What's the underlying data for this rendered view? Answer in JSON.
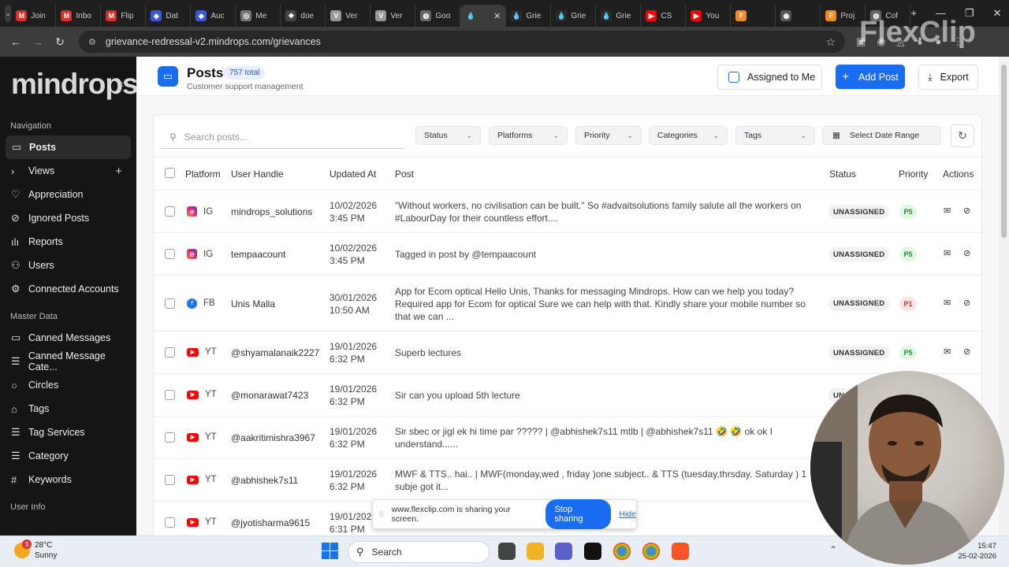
{
  "browser": {
    "tabs": [
      {
        "label": "Join",
        "icon": "gmail-icon",
        "color": "#d93025",
        "glyph": "M"
      },
      {
        "label": "Inbo",
        "icon": "gmail-icon",
        "color": "#d93025",
        "glyph": "M"
      },
      {
        "label": "Flip",
        "icon": "gmail-icon",
        "color": "#d93025",
        "glyph": "M"
      },
      {
        "label": "Dat",
        "icon": "shield-icon",
        "color": "#3a5bd9",
        "glyph": "◆"
      },
      {
        "label": "Auc",
        "icon": "shield-icon",
        "color": "#3a5bd9",
        "glyph": "◆"
      },
      {
        "label": "Me",
        "icon": "app-icon",
        "color": "#777",
        "glyph": "◎"
      },
      {
        "label": "doe",
        "icon": "app-icon",
        "color": "#444",
        "glyph": "❖"
      },
      {
        "label": "Ver",
        "icon": "app-icon",
        "color": "#999",
        "glyph": "V"
      },
      {
        "label": "Ver",
        "icon": "app-icon",
        "color": "#999",
        "glyph": "V"
      },
      {
        "label": "Goo",
        "icon": "globe-icon",
        "color": "#666",
        "glyph": "◍"
      },
      {
        "label": "",
        "icon": "drop-icon",
        "color": "#3c3c3c",
        "glyph": "💧",
        "active": true
      },
      {
        "label": "Grie",
        "icon": "drop-icon",
        "color": "#2a2a2a",
        "glyph": "💧"
      },
      {
        "label": "Grie",
        "icon": "drop-icon",
        "color": "#2a2a2a",
        "glyph": "💧"
      },
      {
        "label": "Grie",
        "icon": "drop-icon",
        "color": "#2a2a2a",
        "glyph": "💧"
      },
      {
        "label": "CS",
        "icon": "youtube-icon",
        "color": "#ff0000",
        "glyph": "▶"
      },
      {
        "label": "You",
        "icon": "youtube-icon",
        "color": "#ff0000",
        "glyph": "▶"
      },
      {
        "label": "",
        "icon": "app-icon",
        "color": "#f58a1f",
        "glyph": "F"
      },
      {
        "label": "",
        "icon": "record-icon",
        "color": "#555",
        "glyph": "◉"
      },
      {
        "label": "Proj",
        "icon": "app-icon",
        "color": "#f58a1f",
        "glyph": "F"
      },
      {
        "label": "Cof",
        "icon": "globe-icon",
        "color": "#666",
        "glyph": "◍"
      }
    ],
    "url": "grievance-redressal-v2.mindrops.com/grievances",
    "watermark": "FlexClip"
  },
  "sidebar": {
    "logo": "mindrops",
    "sections": [
      {
        "heading": "Navigation",
        "items": [
          {
            "label": "Posts",
            "icon": "message-icon",
            "glyph": "▭",
            "active": true
          },
          {
            "label": "Views",
            "icon": "chevron-right-icon",
            "glyph": "›",
            "plus": true
          },
          {
            "label": "Appreciation",
            "icon": "heart-icon",
            "glyph": "♡"
          },
          {
            "label": "Ignored Posts",
            "icon": "ban-icon",
            "glyph": "⊘"
          },
          {
            "label": "Reports",
            "icon": "bar-chart-icon",
            "glyph": "ılı"
          },
          {
            "label": "Users",
            "icon": "users-icon",
            "glyph": "⚇"
          },
          {
            "label": "Connected Accounts",
            "icon": "gear-icon",
            "glyph": "⚙"
          }
        ]
      },
      {
        "heading": "Master Data",
        "items": [
          {
            "label": "Canned Messages",
            "icon": "message-icon",
            "glyph": "▭"
          },
          {
            "label": "Canned Message Cate...",
            "icon": "layers-icon",
            "glyph": "☰"
          },
          {
            "label": "Circles",
            "icon": "circle-icon",
            "glyph": "○"
          },
          {
            "label": "Tags",
            "icon": "tag-icon",
            "glyph": "⌂"
          },
          {
            "label": "Tag Services",
            "icon": "list-icon",
            "glyph": "☰"
          },
          {
            "label": "Category",
            "icon": "list-icon",
            "glyph": "☰"
          },
          {
            "label": "Keywords",
            "icon": "hash-icon",
            "glyph": "#"
          }
        ]
      },
      {
        "heading": "User Info",
        "items": []
      }
    ]
  },
  "header": {
    "title": "Posts",
    "count": "757 total",
    "subtitle": "Customer support management",
    "assigned_label": "Assigned to Me",
    "add_label": "Add Post",
    "export_label": "Export"
  },
  "filters": {
    "search_placeholder": "Search posts...",
    "status": "Status",
    "platforms": "Platforms",
    "priority": "Priority",
    "categories": "Categories",
    "tags": "Tags",
    "date": "Select Date Range"
  },
  "table": {
    "columns": {
      "platform": "Platform",
      "handle": "User Handle",
      "updated": "Updated At",
      "post": "Post",
      "status": "Status",
      "priority": "Priority",
      "actions": "Actions"
    },
    "rows": [
      {
        "platform": "IG",
        "handle": "mindrops_solutions",
        "date": "10/02/2026",
        "time": "3:45 PM",
        "post": "\"Without workers, no civilisation can be built.\" So #advaitsolutions family salute all the workers on #LabourDay for their countless effort....",
        "status": "UNASSIGNED",
        "priority": "P5"
      },
      {
        "platform": "IG",
        "handle": "tempaacount",
        "date": "10/02/2026",
        "time": "3:45 PM",
        "post": "Tagged in post by @tempaacount",
        "status": "UNASSIGNED",
        "priority": "P5"
      },
      {
        "platform": "FB",
        "handle": "Unis Malla",
        "date": "30/01/2026",
        "time": "10:50 AM",
        "post": "App for Ecom optical Hello Unis, Thanks for messaging Mindrops. How can we help you today? Required app for Ecom for optical Sure we can help with that. Kindly share your mobile number so that we can ...",
        "status": "UNASSIGNED",
        "priority": "P1"
      },
      {
        "platform": "YT",
        "handle": "@shyamalanaik2227",
        "date": "19/01/2026",
        "time": "6:32 PM",
        "post": "Superb lectures",
        "status": "UNASSIGNED",
        "priority": "P5"
      },
      {
        "platform": "YT",
        "handle": "@monarawat7423",
        "date": "19/01/2026",
        "time": "6:32 PM",
        "post": "Sir can you upload 5th lecture",
        "status": "UN",
        "priority": ""
      },
      {
        "platform": "YT",
        "handle": "@aakritimishra3967",
        "date": "19/01/2026",
        "time": "6:32 PM",
        "post": "Sir sbec or jigl ek hi time par ????? | @abhishek7s11 mtlb | @abhishek7s11 🤣 🤣 ok ok I understand......",
        "status": "",
        "priority": ""
      },
      {
        "platform": "YT",
        "handle": "@abhishek7s11",
        "date": "19/01/2026",
        "time": "6:32 PM",
        "post": "MWF & TTS.. hai.. | MWF(monday,wed , friday )one subject.. & TTS (tuesday,thrsday, Saturday ) 1 subje got it...",
        "status": "",
        "priority": ""
      },
      {
        "platform": "YT",
        "handle": "@jyotisharma9615",
        "date": "19/01/2026",
        "time": "6:31 PM",
        "post": "",
        "status": "",
        "priority": ""
      }
    ]
  },
  "share": {
    "text": "www.flexclip.com is sharing your screen.",
    "stop": "Stop sharing",
    "hide": "Hide"
  },
  "taskbar": {
    "temp": "28°C",
    "weather": "Sunny",
    "badge": "3",
    "search": "Search",
    "time": "15:47",
    "date": "25-02-2026"
  },
  "colors": {
    "accent": "#1a6cf0",
    "sidebar": "#151515"
  }
}
